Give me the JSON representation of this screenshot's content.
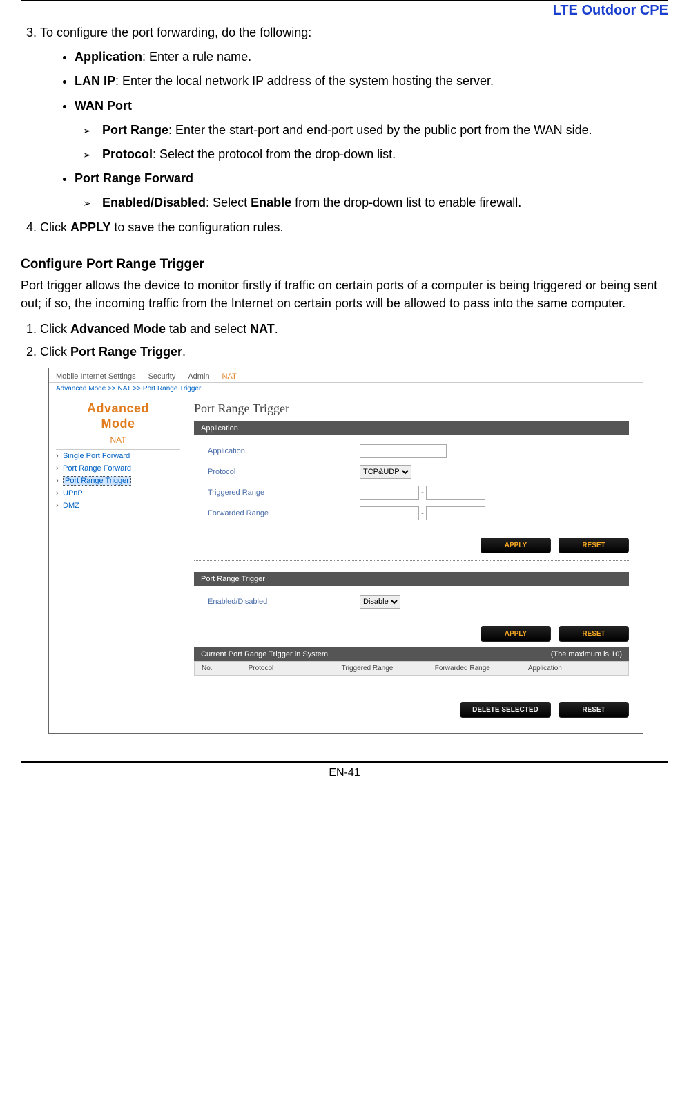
{
  "doc": {
    "title": "LTE Outdoor CPE",
    "page_number": "EN-41"
  },
  "body": {
    "step3_intro": "To configure the port forwarding, do the following:",
    "app_label": "Application",
    "app_desc": ": Enter a rule name.",
    "lanip_label": "LAN IP",
    "lanip_desc": ": Enter the local network IP address of the system hosting the server.",
    "wanport_label": "WAN Port",
    "portrange_label": "Port Range",
    "portrange_desc": ": Enter the start-port and end-port used by the public port from the WAN side.",
    "protocol_label": "Protocol",
    "protocol_desc": ": Select the protocol from the drop-down list.",
    "prf_label": "Port Range Forward",
    "enabled_label": "Enabled/Disabled",
    "enabled_desc_1": ": Select ",
    "enabled_desc_bold": "Enable",
    "enabled_desc_2": " from the drop-down list to enable firewall.",
    "step4_pre": "Click ",
    "step4_bold": "APPLY",
    "step4_post": " to save the configuration rules.",
    "trigger_heading": "Configure Port Range Trigger",
    "trigger_para": "Port trigger allows the device to monitor firstly if traffic on certain ports of a computer is being triggered or being sent out; if so, the incoming traffic from the Internet on certain ports will be allowed to pass into the same computer.",
    "t_step1_pre": "Click ",
    "t_step1_b1": "Advanced Mode",
    "t_step1_mid": " tab and select ",
    "t_step1_b2": "NAT",
    "t_step1_post": ".",
    "t_step2_pre": "Click ",
    "t_step2_b": "Port Range Trigger",
    "t_step2_post": "."
  },
  "ui": {
    "tabs": [
      "Mobile Internet Settings",
      "Security",
      "Admin",
      "NAT"
    ],
    "active_tab_index": 3,
    "breadcrumb": "Advanced Mode >> NAT >> Port Range Trigger",
    "sidebar_title_1": "Advanced",
    "sidebar_title_2": "Mode",
    "nat_label": "NAT",
    "side_items": [
      "Single Port Forward",
      "Port Range Forward",
      "Port Range Trigger",
      "UPnP",
      "DMZ"
    ],
    "side_active_index": 2,
    "content_title": "Port Range Trigger",
    "panel1_head": "Application",
    "panel1_rows": {
      "application": "Application",
      "protocol": "Protocol",
      "protocol_value": "TCP&UDP",
      "triggered": "Triggered Range",
      "forwarded": "Forwarded Range",
      "rangesep": "-"
    },
    "btn_apply": "APPLY",
    "btn_reset": "RESET",
    "panel2_head": "Port Range Trigger",
    "panel2_row_label": "Enabled/Disabled",
    "panel2_row_value": "Disable",
    "table_head": "Current Port Range Trigger in System",
    "table_note": "(The maximum is 10)",
    "cols": [
      "No.",
      "Protocol",
      "Triggered Range",
      "Forwarded Range",
      "Application"
    ],
    "btn_delete": "DELETE SELECTED",
    "btn_reset2": "RESET"
  }
}
